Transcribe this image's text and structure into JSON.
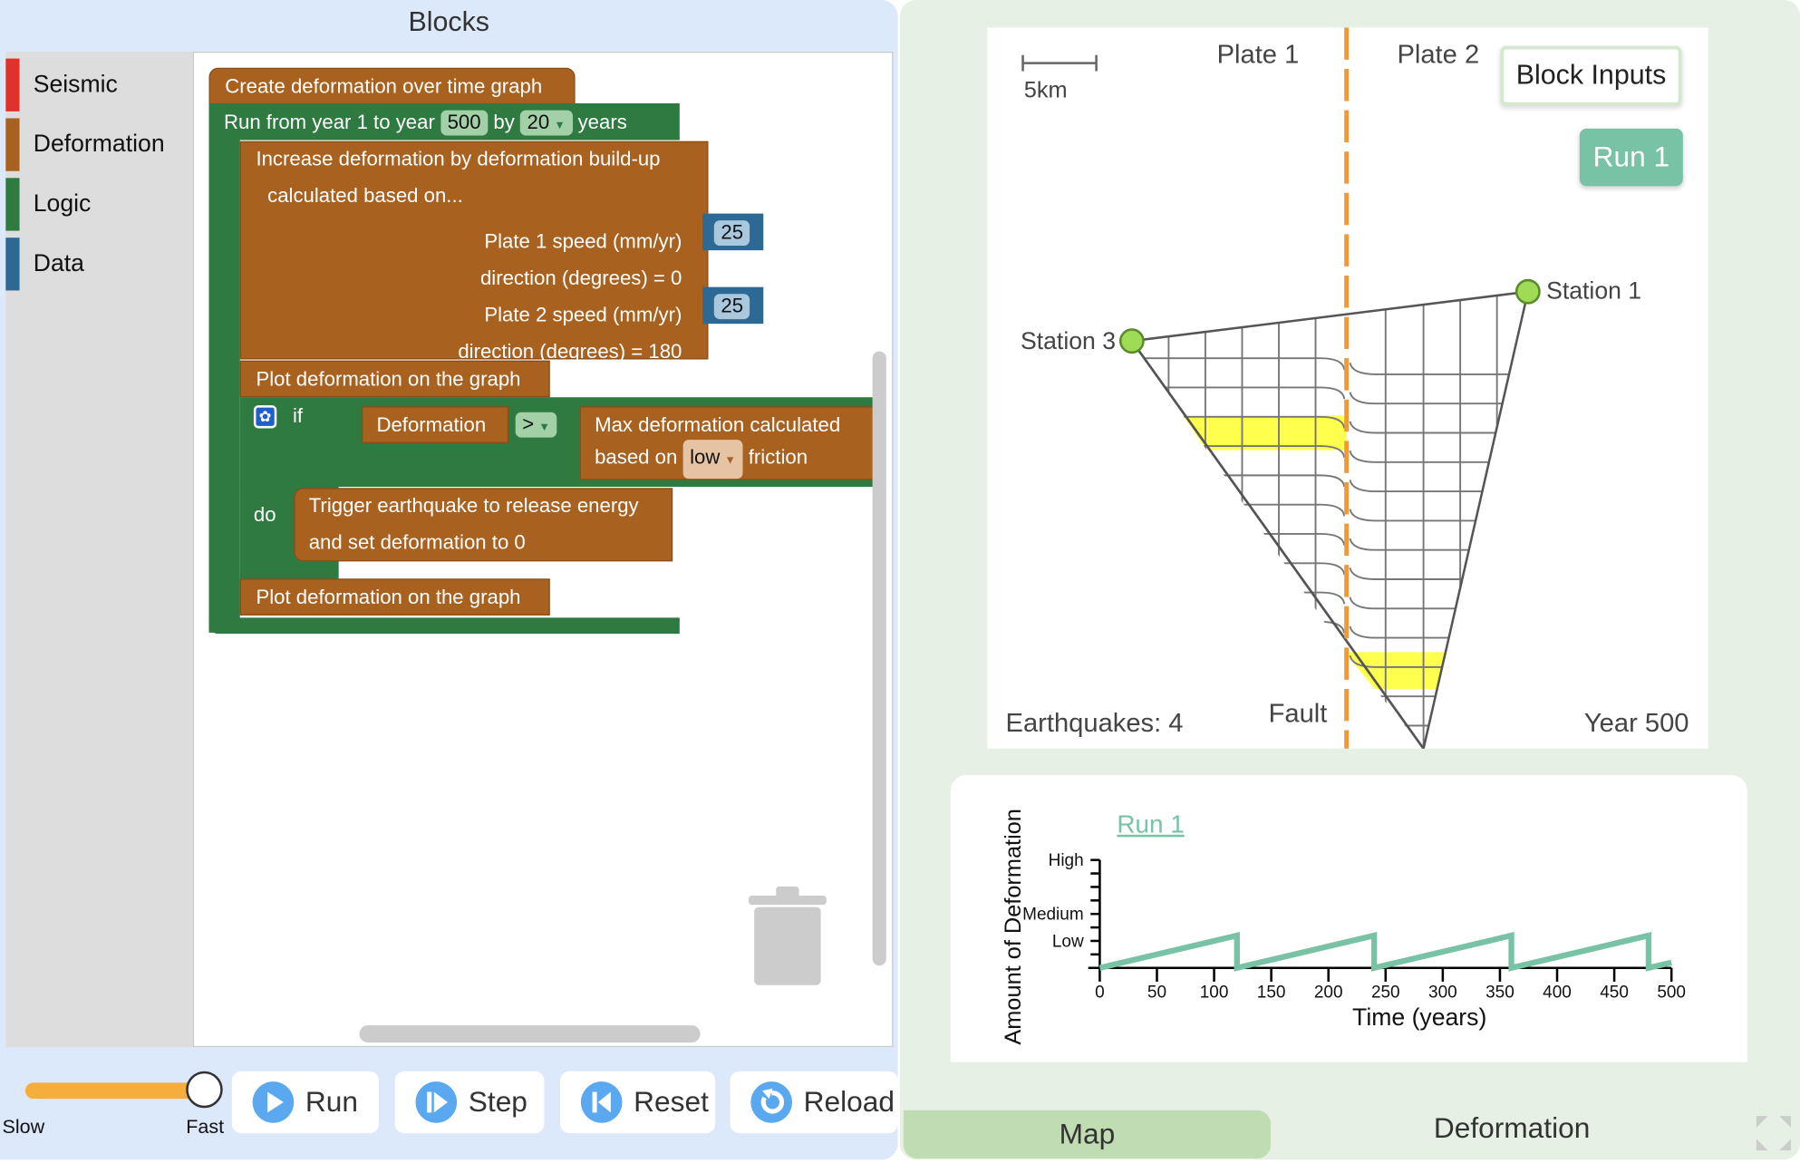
{
  "blocks_panel": {
    "title": "Blocks",
    "categories": [
      {
        "label": "Seismic",
        "color": "#e0312a"
      },
      {
        "label": "Deformation",
        "color": "#a9611f"
      },
      {
        "label": "Logic",
        "color": "#2f7a41"
      },
      {
        "label": "Data",
        "color": "#2c6a95"
      }
    ],
    "program": {
      "create_graph": "Create deformation over time graph",
      "run_from": "Run from year 1 to year",
      "end_year": "500",
      "by": "by",
      "step": "20",
      "years": "years",
      "increase_line1": "Increase deformation by deformation build-up",
      "increase_line2": "calculated based on...",
      "plate1_speed": "Plate 1 speed (mm/yr)",
      "plate1_speed_value": "25",
      "direction1": "direction (degrees) = 0",
      "plate2_speed": "Plate 2 speed (mm/yr)",
      "plate2_speed_value": "25",
      "direction2": "direction (degrees) = 180",
      "plot1": "Plot deformation on the graph",
      "if": "if",
      "deformation": "Deformation",
      "operator": ">",
      "max_line1": "Max deformation calculated",
      "based_on": "based on",
      "friction_value": "low",
      "friction": "friction",
      "do": "do",
      "trigger_line1": "Trigger earthquake to release energy",
      "trigger_line2": "and set deformation to 0",
      "plot2": "Plot deformation on the graph"
    }
  },
  "controls": {
    "speed_slow": "Slow",
    "speed_fast": "Fast",
    "speed_level": 1.0,
    "run": "Run",
    "step": "Step",
    "reset": "Reset",
    "reload": "Reload",
    "slider_color": "#f5ad3c"
  },
  "map": {
    "scale_label": "5km",
    "plate1": "Plate 1",
    "plate2": "Plate 2",
    "block_inputs": "Block Inputs",
    "run_button": "Run 1",
    "station1": "Station 1",
    "station3": "Station 3",
    "earthquakes": "Earthquakes: 4",
    "fault": "Fault",
    "year": "Year 500",
    "fault_color": "#f39a2d",
    "highlight_color": "#ffff4d"
  },
  "chart_data": {
    "type": "line",
    "title": "Run 1",
    "xlabel": "Time (years)",
    "ylabel": "Amount of Deformation",
    "xlim": [
      0,
      500
    ],
    "ylim": [
      0,
      8
    ],
    "xticks": [
      0,
      50,
      100,
      150,
      200,
      250,
      300,
      350,
      400,
      450,
      500
    ],
    "yticks": [
      {
        "value": 2,
        "label": "Low"
      },
      {
        "value": 4,
        "label": "Medium"
      },
      {
        "value": 8,
        "label": "High"
      }
    ],
    "series": [
      {
        "color": "#78c2a6",
        "x": [
          0,
          120,
          120,
          240,
          240,
          360,
          360,
          480,
          480,
          500
        ],
        "y": [
          0,
          2.4,
          0,
          2.4,
          0,
          2.4,
          0,
          2.4,
          0,
          0.4
        ]
      }
    ]
  },
  "tabs": {
    "map": "Map",
    "deformation": "Deformation",
    "active": "Map"
  }
}
